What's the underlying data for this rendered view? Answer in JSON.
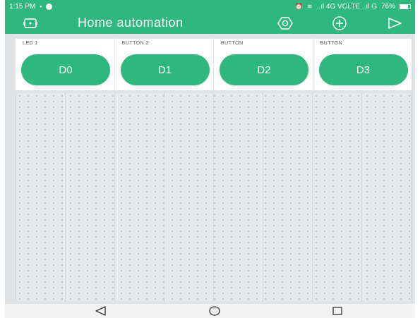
{
  "status_bar": {
    "time": "1:15 PM",
    "network": "..ıl 4G VOLTE ..ıl G",
    "battery": "76%",
    "battery_level": 0.76
  },
  "app_bar": {
    "title": "Home automation",
    "icons": [
      "device-icon",
      "settings-icon",
      "add-icon",
      "play-icon"
    ]
  },
  "widgets": [
    {
      "label": "LED 1",
      "pin": "D0"
    },
    {
      "label": "BUTTON 2",
      "pin": "D1"
    },
    {
      "label": "BUTTON",
      "pin": "D2"
    },
    {
      "label": "BUTTON",
      "pin": "D3"
    }
  ],
  "nav_bar": {
    "icons": [
      "back-icon",
      "home-icon",
      "recents-icon"
    ]
  },
  "colors": {
    "accent": "#2eb87d",
    "canvas": "#dfe3e6",
    "nav": "#f3f3f3"
  }
}
